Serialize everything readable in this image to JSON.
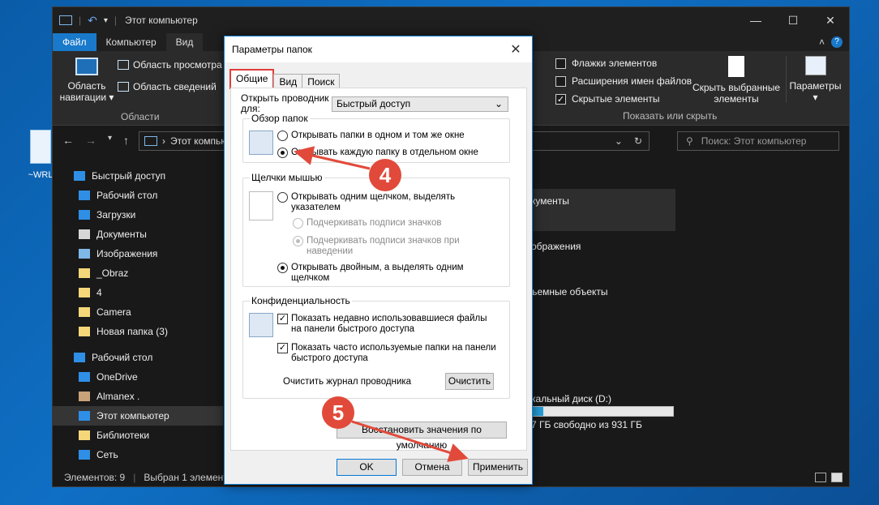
{
  "desktop": {
    "icon_label": "~WRL"
  },
  "explorer": {
    "title": "Этот компьютер",
    "tabs": [
      "Файл",
      "Компьютер",
      "Вид"
    ],
    "ribbon": {
      "nav_pane": "Область навигации",
      "preview_pane": "Область просмотра",
      "details_pane": "Область сведений",
      "areas_label": "Области",
      "checks": [
        {
          "label": "Флажки элементов",
          "checked": false
        },
        {
          "label": "Расширения имен файлов",
          "checked": false
        },
        {
          "label": "Скрытые элементы",
          "checked": true
        }
      ],
      "hide_selected": "Скрыть выбранные элементы",
      "show_hide_label": "Показать или скрыть",
      "options": "Параметры"
    },
    "address": "Этот компьютер",
    "search_placeholder": "Поиск: Этот компьютер",
    "sidebar": [
      {
        "label": "Быстрый доступ",
        "icon": "star-icon",
        "color": "#2f8fe6"
      },
      {
        "label": "Рабочий стол",
        "icon": "desktop-icon",
        "color": "#2f8fe6"
      },
      {
        "label": "Загрузки",
        "icon": "download-icon",
        "color": "#2f8fe6"
      },
      {
        "label": "Документы",
        "icon": "document-icon",
        "color": "#d7d7d7"
      },
      {
        "label": "Изображения",
        "icon": "pictures-icon",
        "color": "#7fb8e8"
      },
      {
        "label": "_Obraz",
        "icon": "folder-icon",
        "color": "#f5d77a"
      },
      {
        "label": "4",
        "icon": "folder-icon",
        "color": "#f5d77a"
      },
      {
        "label": "Camera",
        "icon": "folder-icon",
        "color": "#f5d77a"
      },
      {
        "label": "Новая папка (3)",
        "icon": "folder-icon",
        "color": "#f5d77a"
      },
      {
        "label": "Рабочий стол",
        "icon": "desktop-icon",
        "color": "#2f8fe6"
      },
      {
        "label": "OneDrive",
        "icon": "cloud-icon",
        "color": "#2f8fe6"
      },
      {
        "label": "Almanex .",
        "icon": "user-icon",
        "color": "#c9a27a"
      },
      {
        "label": "Этот компьютер",
        "icon": "computer-icon",
        "color": "#2f8fe6",
        "selected": true
      },
      {
        "label": "Библиотеки",
        "icon": "library-icon",
        "color": "#f5d77a"
      },
      {
        "label": "Сеть",
        "icon": "network-icon",
        "color": "#2f8fe6"
      }
    ],
    "main_partial": {
      "documents": "кументы",
      "images": "ображения",
      "removable": "ъемные объекты",
      "disk": "кальный диск (D:)",
      "disk_free": "7 ГБ свободно из 931 ГБ",
      "disk_used_fraction": 0.08
    },
    "status": {
      "items": "Элементов: 9",
      "selected": "Выбран 1 элемент"
    }
  },
  "dialog": {
    "title": "Параметры папок",
    "tabs": [
      "Общие",
      "Вид",
      "Поиск"
    ],
    "open_explorer_for": "Открыть проводник для:",
    "open_explorer_value": "Быстрый доступ",
    "browse_group": "Обзор папок",
    "browse_same": "Открывать папки в одном и том же окне",
    "browse_new": "Открывать каждую папку в отдельном окне",
    "click_group": "Щелчки мышью",
    "click_single": "Открывать одним щелчком, выделять указателем",
    "underline_browser": "Подчеркивать подписи значков",
    "underline_hover": "Подчеркивать подписи значков при наведении",
    "click_double": "Открывать двойным, а выделять одним щелчком",
    "privacy_group": "Конфиденциальность",
    "show_recent": "Показать недавно использовавшиеся файлы на панели быстрого доступа",
    "show_frequent": "Показать часто используемые папки на панели быстрого доступа",
    "clear_history": "Очистить журнал проводника",
    "clear_button": "Очистить",
    "restore_defaults": "Восстановить значения по умолчанию",
    "ok": "OK",
    "cancel": "Отмена",
    "apply": "Применить"
  },
  "annotations": {
    "step4": "4",
    "step5": "5",
    "color": "#e14a3a"
  }
}
